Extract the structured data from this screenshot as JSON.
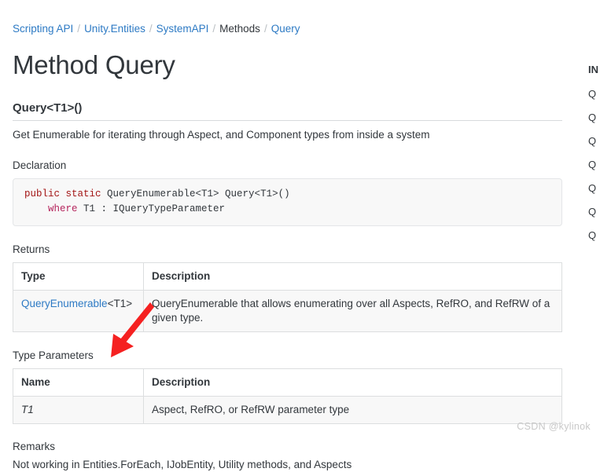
{
  "breadcrumb": {
    "separator": "/",
    "items": [
      {
        "label": "Scripting API",
        "type": "link"
      },
      {
        "label": "Unity.Entities",
        "type": "link"
      },
      {
        "label": "SystemAPI",
        "type": "link"
      },
      {
        "label": "Methods",
        "type": "current"
      },
      {
        "label": "Query",
        "type": "link"
      }
    ]
  },
  "page": {
    "title": "Method Query",
    "signature_heading": "Query<T1>()",
    "summary": "Get Enumerable for iterating through Aspect, and Component types from inside a system"
  },
  "declaration": {
    "label": "Declaration",
    "line1_keywords": "public static ",
    "line1_rest": "QueryEnumerable<T1> Query<T1>()",
    "line2_indent": "    ",
    "line2_keyword": "where ",
    "line2_rest": "T1 : IQueryTypeParameter"
  },
  "returns": {
    "label": "Returns",
    "headers": [
      "Type",
      "Description"
    ],
    "row": {
      "type_link": "QueryEnumerable",
      "type_generic": "<T1>",
      "description": "QueryEnumerable that allows enumerating over all Aspects, RefRO, and RefRW of a given type."
    }
  },
  "type_parameters": {
    "label": "Type Parameters",
    "headers": [
      "Name",
      "Description"
    ],
    "row": {
      "name": "T1",
      "description": "Aspect, RefRO, or RefRW parameter type"
    }
  },
  "remarks": {
    "label": "Remarks",
    "text": "Not working in Entities.ForEach, IJobEntity, Utility methods, and Aspects"
  },
  "sidebar": {
    "title": "IN",
    "items": [
      {
        "label": "Q"
      },
      {
        "label": "Q"
      },
      {
        "label": "Q"
      },
      {
        "label": "Q"
      },
      {
        "label": "Q"
      },
      {
        "label": "Q"
      },
      {
        "label": "Q"
      }
    ]
  },
  "annotation": {
    "arrow_color": "#f52121"
  },
  "watermark": {
    "text": "CSDN @kylinok"
  }
}
